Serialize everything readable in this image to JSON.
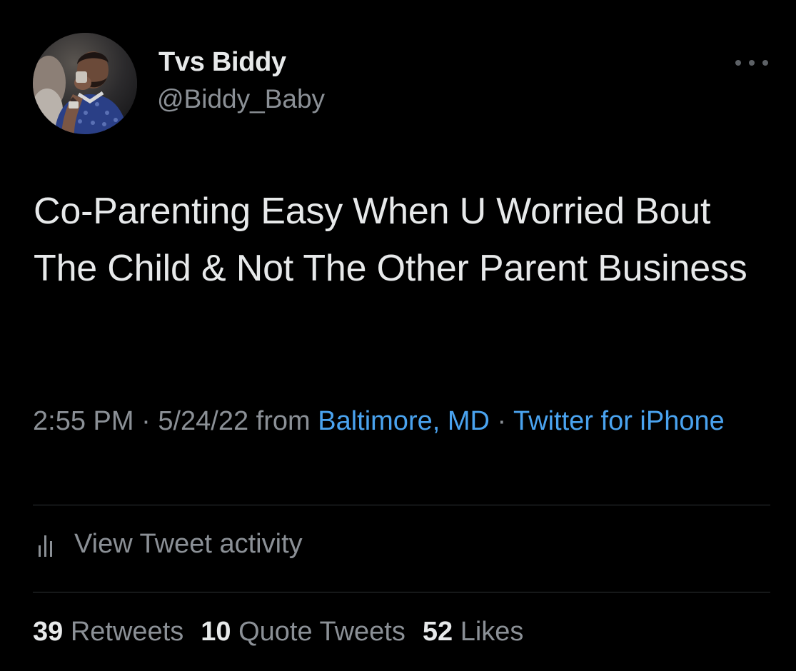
{
  "user": {
    "name": "Tvs Biddy",
    "handle": "@Biddy_Baby"
  },
  "tweet": {
    "text": "Co-Parenting Easy When U Worried Bout The Child & Not The Other Parent Business"
  },
  "meta": {
    "time": "2:55 PM",
    "separator1": " · ",
    "date": "5/24/22",
    "from_word": " from ",
    "location": "Baltimore, MD",
    "separator2": " · ",
    "client": "Twitter for iPhone"
  },
  "activity": {
    "label": "View Tweet activity",
    "icon": "bar-chart-icon"
  },
  "stats": {
    "retweets_count": "39",
    "retweets_label": "Retweets",
    "quotes_count": "10",
    "quotes_label": "Quote Tweets",
    "likes_count": "52",
    "likes_label": "Likes"
  },
  "colors": {
    "background": "#000000",
    "primary_text": "#e7e9ea",
    "secondary_text": "#8b9096",
    "link": "#4aa3ef",
    "divider": "#2f3336"
  }
}
